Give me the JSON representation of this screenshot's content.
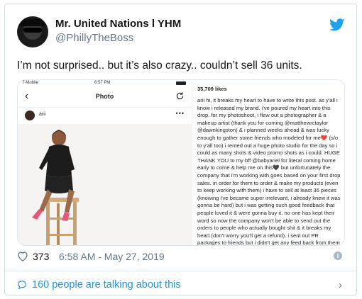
{
  "author": {
    "name": "Mr. United Nations l YHM",
    "handle": "@PhillyTheBoss"
  },
  "tweet": {
    "text": "I’m not surprised.. but it’s also crazy.. couldn’t sell 36 units."
  },
  "embedded_screenshot": {
    "status_left": "T-Mobile",
    "status_time": "6:57 PM",
    "nav_title": "Photo",
    "username": "arii",
    "likes": "35,709 likes",
    "caption": "arii hi, it breaks my heart to have to write this post. as y'all i know i released my brand. i've poured my heart into this drop. for my photoshoot, i flew out a photographer & a makeup artist (thank you for coming @matthewrctaylor @dawnkingston) & i planned weeks ahead & was lucky enough to gather some friends who modeled for me❤️ (s/o to y'all too) i rented out a huge photo studio for the day so i could as many shots & video promo shots as i could. HUGE THANK YOU to my bff @babyariel for literal coming home early to come & help me on this🖤 but unfortunately the company that i'm working with goes based on your first drop sales. in order for them to order & make my products (even to keep working with them) i have to sell at least 36 pieces (knowing i've became super irrelevant, i already knew it was gonna be hard) but i was getting such good feedback that people loved it & were gonna buy it. no one has kept their word so now the company won't be able to send out the orders to people who actually bought shit & it breaks my heart (don't worry you'll get a refund). i sent out PR packages to friends but i didn't get any feed back from them (which i can"
  },
  "meta": {
    "like_count": "373",
    "timestamp": "6:58 AM - May 27, 2019"
  },
  "footer": {
    "talking": "160 people are talking about this"
  },
  "colors": {
    "twitter_blue": "#1da1f2",
    "link_blue": "#1b95e0",
    "secondary_text": "#657786"
  }
}
